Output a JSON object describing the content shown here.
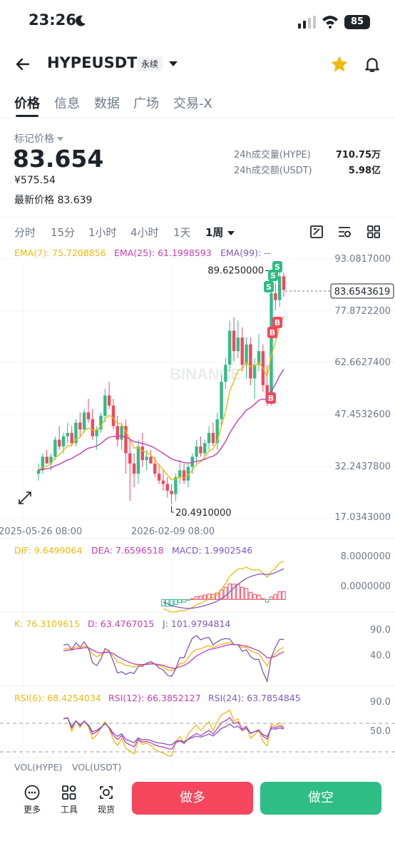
{
  "status_bar": {
    "time": "23:26",
    "battery": "85"
  },
  "header": {
    "pair": "HYPEUSDT",
    "contract_tag": "永续"
  },
  "tabs": [
    "价格",
    "信息",
    "数据",
    "广场",
    "交易-X"
  ],
  "price_panel": {
    "mark_price_label": "标记价格",
    "mark_price": "83.654",
    "cny_price": "¥575.54",
    "last_price_label": "最新价格",
    "last_price": "83.639",
    "stats": [
      {
        "label": "24h成交量(HYPE)",
        "value": "710.75万"
      },
      {
        "label": "24h成交额(USDT)",
        "value": "5.98亿"
      }
    ]
  },
  "intervals": [
    "分时",
    "15分",
    "1小时",
    "4小时",
    "1天",
    "1周"
  ],
  "active_interval": "1周",
  "ema": {
    "ema7": "EMA(7): 75.7208856",
    "ema25": "EMA(25): 61.1998593",
    "ema99": "EMA(99): --"
  },
  "price_axis": [
    "93.0817000",
    "77.8722200",
    "62.6627400",
    "47.4532600",
    "32.2437800",
    "17.0343000"
  ],
  "current_price_tag": "83.6543619",
  "high_marker": "89.6250000",
  "low_marker": "20.4910000",
  "time_axis": [
    "2025-05-26 08:00",
    "2026-02-09 08:00"
  ],
  "watermark": "BINANCE",
  "macd": {
    "dif": "DIF: 9.6499064",
    "dea": "DEA: 7.6596518",
    "macd": "MACD: 1.9902546",
    "axis": [
      "8.0000000",
      "0.0000000"
    ]
  },
  "kdj": {
    "k": "K: 76.3109615",
    "d": "D: 63.4767015",
    "j": "J: 101.9794814",
    "axis": [
      "90.0",
      "40.0"
    ]
  },
  "rsi": {
    "rsi6": "RSI(6): 68.4254034",
    "rsi12": "RSI(12): 66.3852127",
    "rsi24": "RSI(24): 63.7854845",
    "axis": [
      "90.0",
      "50.0"
    ]
  },
  "vol": {
    "hype": "VOL(HYPE)",
    "usdt": "VOL(USDT)"
  },
  "trade_signals": [
    "S",
    "S",
    "S",
    "B",
    "B",
    "B"
  ],
  "bottom_bar": {
    "more": "更多",
    "tools": "工具",
    "spot": "现货",
    "long": "做多",
    "short": "做空"
  },
  "colors": {
    "up": "#2ebd85",
    "down": "#f6465d",
    "ema7": "#f0b90b",
    "ema25": "#c93bb5",
    "ema99": "#7e57c2",
    "accent": "#f0b90b"
  },
  "chart_data": {
    "type": "candlestick",
    "interval": "1周",
    "x_range": [
      "2025-05-26 08:00",
      "2026-02-09 08:00"
    ],
    "ylim": [
      17.0343,
      93.0817
    ],
    "candles_ohlc": [
      [
        30,
        33,
        28,
        31
      ],
      [
        31,
        36,
        30,
        35
      ],
      [
        35,
        37,
        33,
        33
      ],
      [
        33,
        36,
        31,
        35
      ],
      [
        35,
        41,
        34,
        40
      ],
      [
        40,
        44,
        37,
        38
      ],
      [
        38,
        42,
        36,
        41
      ],
      [
        41,
        45,
        39,
        42
      ],
      [
        42,
        44,
        38,
        39
      ],
      [
        39,
        46,
        38,
        45
      ],
      [
        45,
        48,
        41,
        43
      ],
      [
        43,
        49,
        42,
        48
      ],
      [
        48,
        52,
        45,
        46
      ],
      [
        46,
        49,
        40,
        41
      ],
      [
        41,
        44,
        37,
        43
      ],
      [
        43,
        48,
        42,
        47
      ],
      [
        47,
        55,
        45,
        53
      ],
      [
        53,
        57,
        49,
        50
      ],
      [
        50,
        52,
        43,
        44
      ],
      [
        44,
        47,
        38,
        40
      ],
      [
        40,
        45,
        37,
        44
      ],
      [
        44,
        46,
        30,
        36
      ],
      [
        36,
        40,
        22,
        33
      ],
      [
        33,
        36,
        26,
        30
      ],
      [
        30,
        40,
        27,
        38
      ],
      [
        38,
        42,
        32,
        34
      ],
      [
        34,
        37,
        31,
        35
      ],
      [
        35,
        37,
        33,
        33
      ],
      [
        33,
        35,
        29,
        30
      ],
      [
        30,
        33,
        27,
        28
      ],
      [
        28,
        31,
        25,
        27
      ],
      [
        27,
        29,
        23,
        25
      ],
      [
        25,
        27,
        21,
        24
      ],
      [
        24,
        30,
        22,
        29
      ],
      [
        29,
        34,
        27,
        31
      ],
      [
        31,
        33,
        27,
        28
      ],
      [
        28,
        33,
        26,
        32
      ],
      [
        32,
        36,
        30,
        35
      ],
      [
        35,
        40,
        33,
        38
      ],
      [
        38,
        41,
        35,
        36
      ],
      [
        36,
        40,
        34,
        39
      ],
      [
        39,
        44,
        37,
        42
      ],
      [
        42,
        45,
        38,
        39
      ],
      [
        39,
        48,
        37,
        46
      ],
      [
        46,
        59,
        44,
        57
      ],
      [
        57,
        64,
        55,
        62
      ],
      [
        62,
        75,
        60,
        72
      ],
      [
        72,
        76,
        63,
        66
      ],
      [
        66,
        75,
        64,
        70
      ],
      [
        70,
        73,
        60,
        62
      ],
      [
        62,
        70,
        58,
        68
      ],
      [
        68,
        70,
        56,
        58
      ],
      [
        58,
        64,
        52,
        62
      ],
      [
        62,
        71,
        60,
        66
      ],
      [
        66,
        68,
        54,
        56
      ],
      [
        56,
        62,
        50,
        51
      ],
      [
        51,
        85,
        50,
        83
      ],
      [
        83,
        86,
        78,
        81
      ],
      [
        81,
        90,
        79,
        88
      ],
      [
        88,
        89,
        82,
        84
      ]
    ],
    "markers": {
      "high": 89.625,
      "low": 20.491,
      "current": 83.6543619
    }
  }
}
